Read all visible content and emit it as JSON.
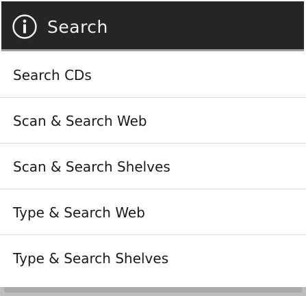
{
  "dialog": {
    "title": "Search",
    "title_icon": "info-icon",
    "title_bar_color": "#252525"
  },
  "menu": {
    "items": [
      {
        "label": "Search CDs"
      },
      {
        "label": "Scan & Search Web"
      },
      {
        "label": "Scan & Search Shelves"
      },
      {
        "label": "Type & Search Web"
      },
      {
        "label": "Type & Search Shelves"
      }
    ]
  }
}
